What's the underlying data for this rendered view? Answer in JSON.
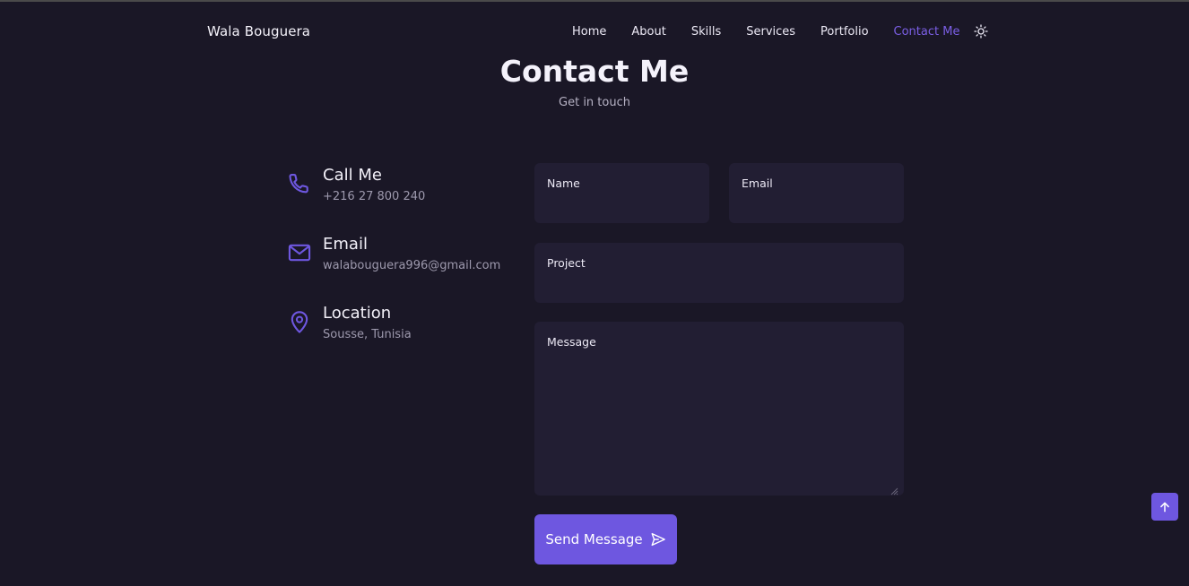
{
  "header": {
    "logo": "Wala Bouguera",
    "nav": [
      "Home",
      "About",
      "Skills",
      "Services",
      "Portfolio",
      "Contact Me"
    ],
    "active_nav": "Contact Me",
    "theme_icon": "sun-icon"
  },
  "section": {
    "title": "Contact Me",
    "subtitle": "Get in touch"
  },
  "contact_info": [
    {
      "icon": "phone-icon",
      "title": "Call Me",
      "value": "+216 27 800 240"
    },
    {
      "icon": "mail-icon",
      "title": "Email",
      "value": "walabouguera996@gmail.com"
    },
    {
      "icon": "location-pin-icon",
      "title": "Location",
      "value": "Sousse, Tunisia"
    }
  ],
  "form": {
    "name_label": "Name",
    "email_label": "Email",
    "project_label": "Project",
    "message_label": "Message",
    "name_value": "",
    "email_value": "",
    "project_value": "",
    "message_value": "",
    "submit_label": "Send Message"
  },
  "colors": {
    "background": "#1a1726",
    "accent": "#6e57e0",
    "field_background": "#221e33",
    "muted_text": "#9d99ad"
  },
  "scroll_up_icon": "arrow-up-icon"
}
